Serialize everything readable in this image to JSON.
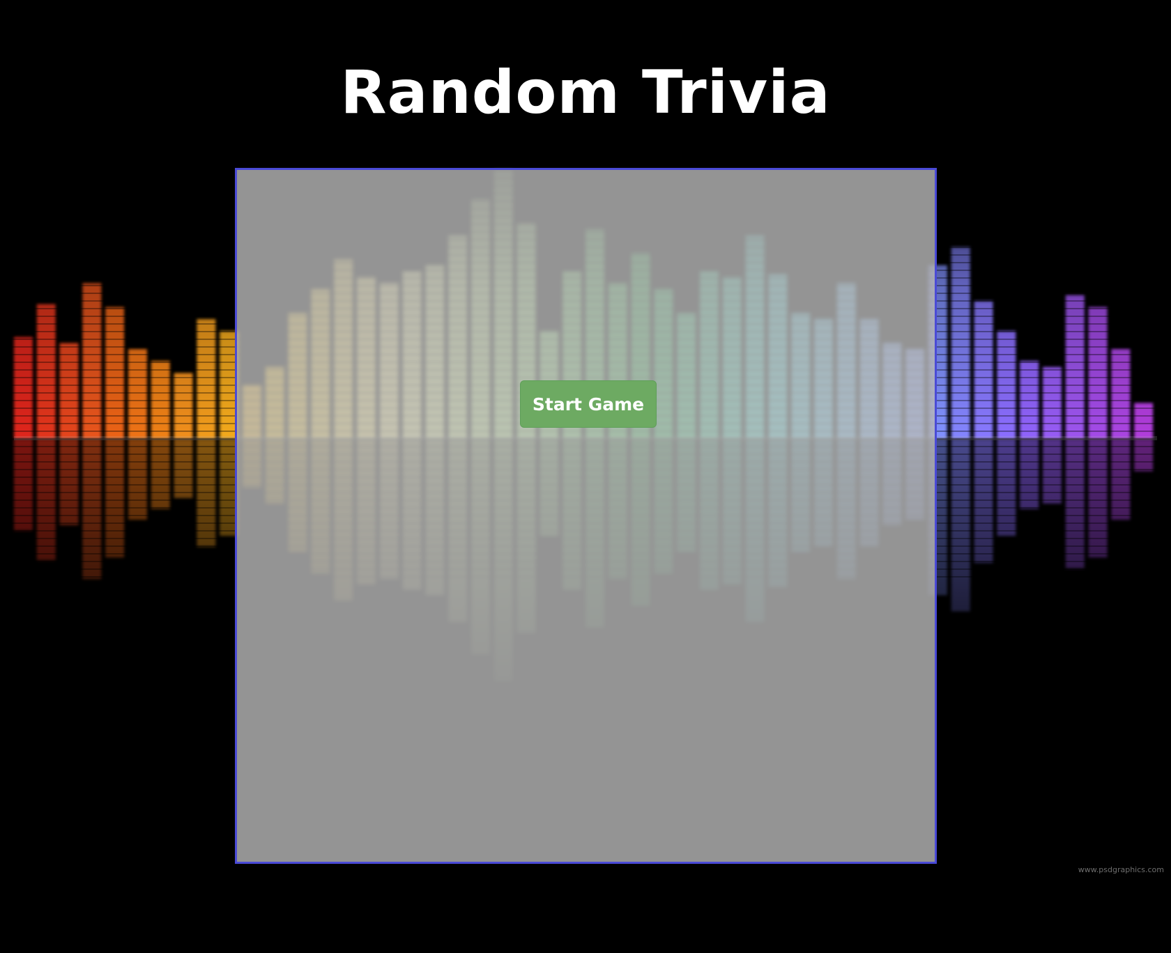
{
  "page": {
    "title": "Random Trivia"
  },
  "game": {
    "start_label": "Start Game"
  },
  "watermark": "www.psdgraphics.com",
  "colors": {
    "background": "#000000",
    "panel": "#b9b9b9",
    "panel_border": "#4a4ad6",
    "button": "#6daa62",
    "title_text": "#ffffff"
  },
  "background_image": {
    "type": "equalizer-bars",
    "spectrum": [
      "#e0261c",
      "#f07a18",
      "#f4c21e",
      "#f7ef9a",
      "#b6ef8f",
      "#37c25a",
      "#53d9d9",
      "#7aa7ff",
      "#8d67ff",
      "#b13cdc"
    ]
  }
}
